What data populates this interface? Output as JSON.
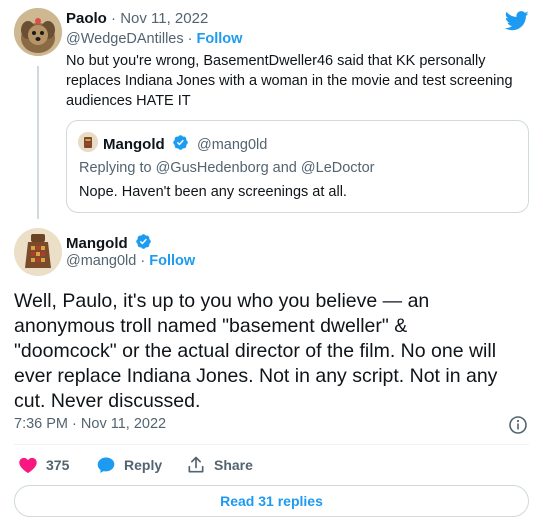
{
  "reply_tweet": {
    "display_name": "Paolo",
    "separator": "·",
    "date": "Nov 11, 2022",
    "handle": "@WedgeDAntilles",
    "follow_label": "Follow",
    "text_line1": "No but you're wrong, BasementDweller46 said that KK personally",
    "text_line2": "replaces Indiana Jones with a woman in the movie and test screening",
    "text_line3": "audiences HATE IT"
  },
  "quoted_tweet": {
    "display_name": "Mangold",
    "handle": "@mang0ld",
    "replying_prefix": "Replying to",
    "replying_to_1": "@GusHedenborg",
    "replying_and": "and",
    "replying_to_2": "@LeDoctor",
    "text": "Nope. Haven't been any screenings at all."
  },
  "main_tweet": {
    "display_name": "Mangold",
    "handle": "@mang0ld",
    "separator": "·",
    "follow_label": "Follow",
    "text_lines": [
      "Well, Paulo, it's up to you who you believe — an",
      "anonymous troll named \"basement dweller\" &",
      "\"doomcock\" or the actual director of the film. No one will",
      "ever replace Indiana Jones. Not in any script. Not in any",
      "cut. Never discussed."
    ],
    "time": "7:36 PM",
    "date": "Nov 11, 2022",
    "time_separator": "·"
  },
  "actions": {
    "like_count": "375",
    "reply_label": "Reply",
    "share_label": "Share"
  },
  "read_replies_label": "Read 31 replies",
  "colors": {
    "accent": "#1d9bf0",
    "text": "#0f1419",
    "muted": "#536471",
    "like": "#f91880",
    "border": "#cfd9de",
    "verified": "#1d9bf0"
  },
  "icons": {
    "brand": "twitter-bird-icon",
    "verified": "verified-badge-icon",
    "info": "info-icon",
    "like": "heart-icon",
    "reply": "reply-bubble-icon",
    "share": "share-icon"
  }
}
